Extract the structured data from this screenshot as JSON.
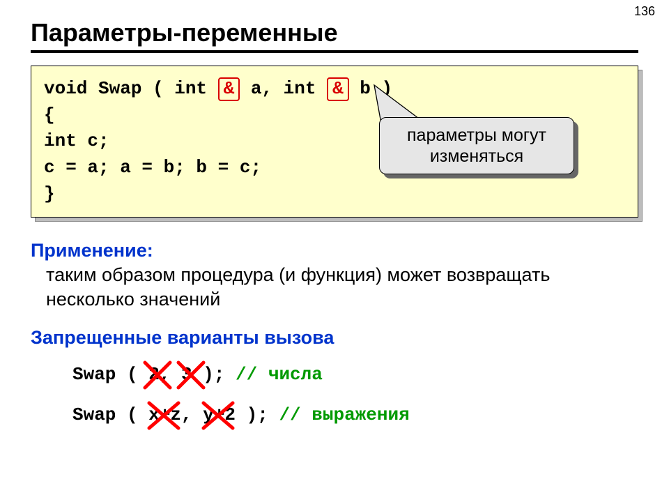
{
  "page_number": "136",
  "title": "Параметры-переменные",
  "code": {
    "line1a": "void Swap ( int ",
    "amp_a": "&",
    "line1b": " a, int ",
    "amp_b": "&",
    "line1c": " b )",
    "line2": "{",
    "line3": " int c;",
    "line4": " c = a; a = b; b = c;",
    "line5": "}"
  },
  "callout": {
    "line1": "параметры могут",
    "line2": "изменяться"
  },
  "usage": {
    "heading": "Применение:",
    "text": "таким образом процедура (и функция) может возвращать несколько значений"
  },
  "forbidden": {
    "heading": "Запрещенные варианты вызова",
    "ex1_code": "Swap ( 2, 3 );     ",
    "ex1_comment": "// числа",
    "ex2_code": "Swap ( x+z, y+2 ); ",
    "ex2_comment": "// выражения"
  }
}
